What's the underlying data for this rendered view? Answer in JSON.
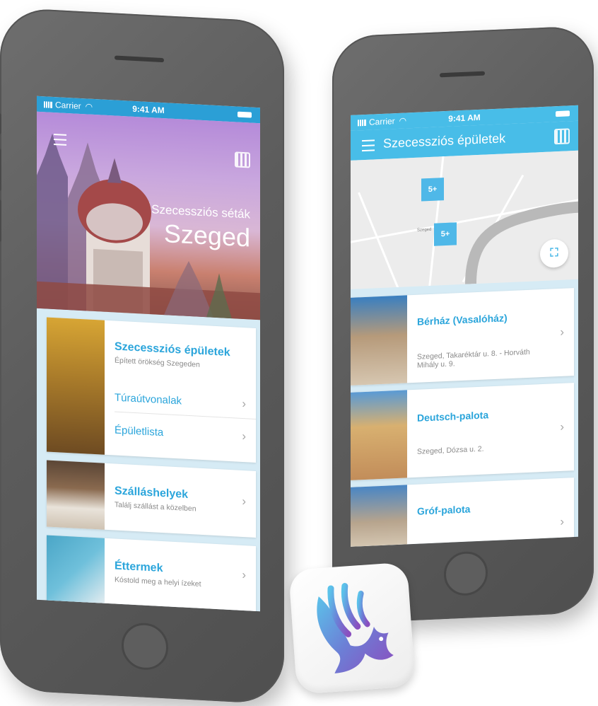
{
  "left_phone": {
    "status": {
      "carrier": "Carrier",
      "time": "9:41 AM"
    },
    "hero": {
      "subtitle": "Szecessziós séták",
      "title": "Szeged"
    },
    "cards": [
      {
        "title": "Szecessziós épületek",
        "subtitle": "Épített örökség Szegeden",
        "links": [
          "Túraútvonalak",
          "Épületlista"
        ]
      },
      {
        "title": "Szálláshelyek",
        "subtitle": "Találj szállást a közelben"
      },
      {
        "title": "Éttermek",
        "subtitle": "Kóstold meg a helyi ízeket"
      }
    ]
  },
  "right_phone": {
    "status": {
      "carrier": "Carrier",
      "time": "9:41 AM"
    },
    "header_title": "Szecessziós épületek",
    "map": {
      "clusters": [
        "5+",
        "5+"
      ],
      "street_label": "Szeged"
    },
    "buildings": [
      {
        "name": "Bérház (Vasalóház)",
        "address": "Szeged, Takaréktár u. 8. - Horváth Mihály u. 9."
      },
      {
        "name": "Deutsch-palota",
        "address": "Szeged, Dózsa u. 2."
      },
      {
        "name": "Gróf-palota",
        "address": ""
      }
    ]
  },
  "colors": {
    "accent": "#2ba5db",
    "header": "#48bde8",
    "hero_purple": "#b58bd9"
  },
  "icons": [
    "menu-icon",
    "qr-code-icon",
    "wifi-icon",
    "chevron-right-icon",
    "fullscreen-icon",
    "app-logo-icon"
  ]
}
